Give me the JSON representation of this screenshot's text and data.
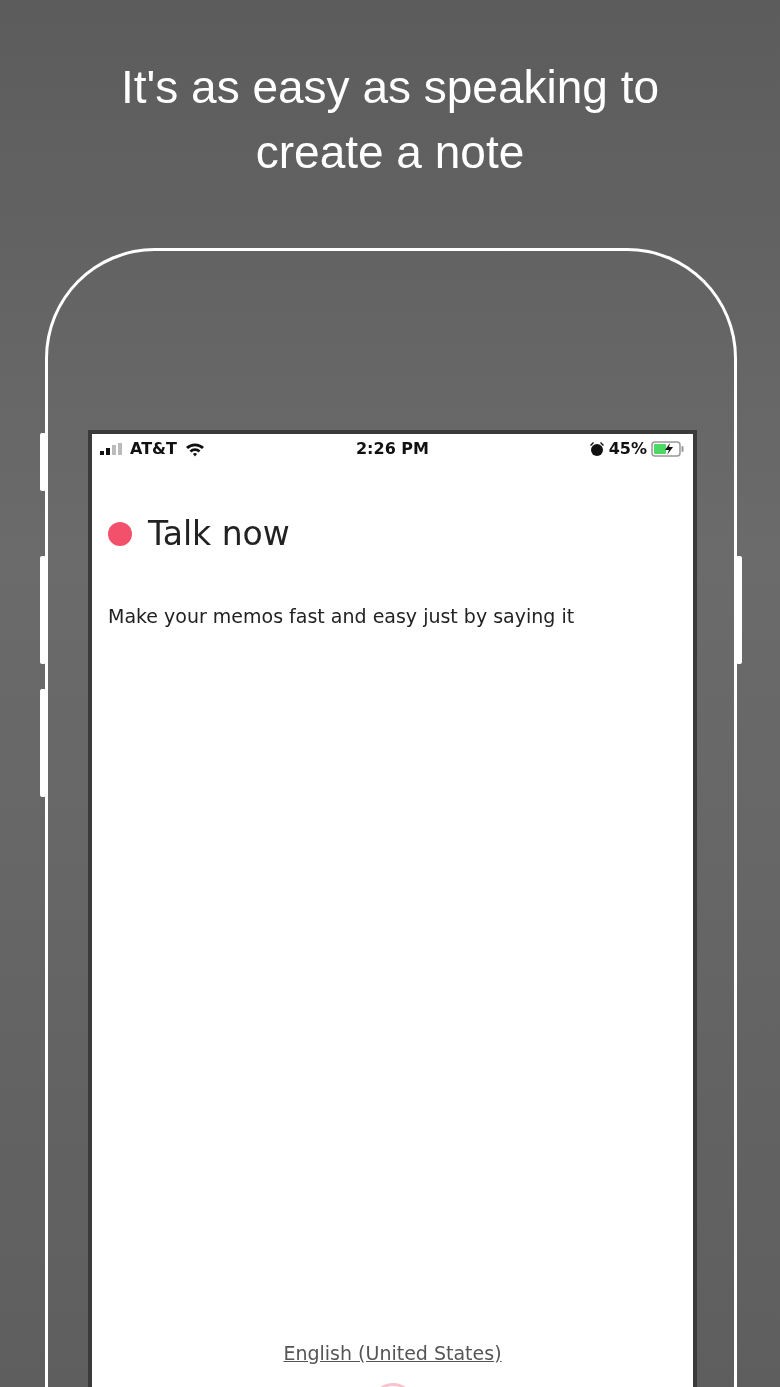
{
  "headline": "It's as easy as speaking to create a note",
  "status_bar": {
    "carrier": "AT&T",
    "time": "2:26 PM",
    "battery": "45%"
  },
  "title": "Talk now",
  "subtitle": "Make your memos fast and easy just by saying it",
  "language_link": "English (United States)"
}
